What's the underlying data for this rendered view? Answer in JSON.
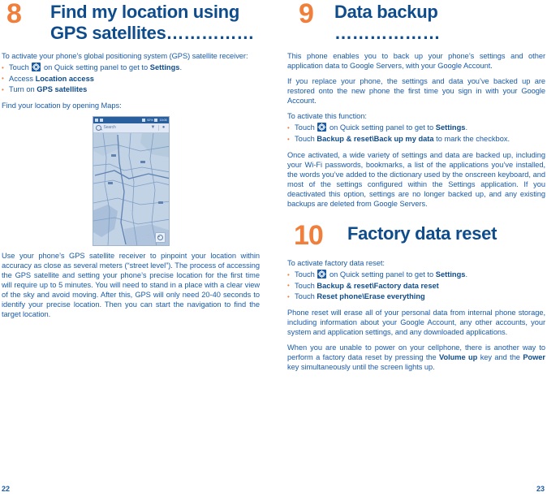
{
  "document": {
    "page_left_number": "22",
    "page_right_number": "23",
    "colors": {
      "chapter_number": "#f07f3c",
      "heading": "#0f4c8c",
      "body": "#1a5ba6",
      "bullet": "#f07f3c"
    }
  },
  "left_column": {
    "chapter": {
      "number": "8",
      "title": "Find my location using GPS satellites……………"
    },
    "intro": "To activate your phone’s global positioning system (GPS) satellite receiver:",
    "bullets": [
      {
        "prefix": "Touch ",
        "icon": "gear-icon",
        "middle": " on Quick setting panel to get to ",
        "bold": "Settings",
        "suffix": "."
      },
      {
        "prefix": "Access ",
        "icon": null,
        "middle": "",
        "bold": "Location access",
        "suffix": ""
      },
      {
        "prefix": "Turn on ",
        "icon": null,
        "middle": "",
        "bold": "GPS satellites",
        "suffix": ""
      }
    ],
    "maps_line": "Find your location by opening Maps:",
    "phone_screenshot": {
      "app_name": "maps-app",
      "status_battery": "92%",
      "status_time": "15:05",
      "search_placeholder": "Search",
      "search_icon": "search-icon",
      "layers_icon": "layers-icon",
      "person_icon": "person-icon",
      "my_location_icon": "my-location-icon"
    },
    "closing_paragraph": "Use your phone’s GPS satellite receiver to pinpoint your location within accuracy as close as several meters (“street level”). The process of accessing the GPS satellite and setting your phone’s precise location for the first time will require up to 5 minutes. You will need to stand in a place with a clear view of the sky and avoid moving. After this, GPS will only need 20-40 seconds to identify your precise location. Then you can start the navigation to find the target location."
  },
  "right_column": {
    "chapter9": {
      "number": "9",
      "title": "Data backup ………………",
      "paragraph1": "This phone enables you to back up your phone’s settings and other application data to Google Servers, with your Google Account.",
      "paragraph2": "If you replace your phone, the settings and data you’ve backed up are restored onto the new phone the first time you sign in with your Google Account.",
      "activate_line": "To activate this function:",
      "bullets": [
        {
          "prefix": "Touch ",
          "icon": "gear-icon",
          "middle": " on Quick setting panel to get to ",
          "bold": "Settings",
          "suffix": "."
        },
        {
          "prefix": "Touch ",
          "icon": null,
          "middle": "",
          "bold": "Backup & reset\\Back up my data",
          "suffix": " to mark the checkbox."
        }
      ],
      "paragraph3": "Once activated, a wide variety of settings and data are backed up, including your Wi-Fi passwords, bookmarks, a list of the applications you’ve installed, the words you’ve added to the dictionary used by the onscreen keyboard, and most of the settings configured within the Settings application. If you deactivated this option, settings are no longer backed up, and any existing backups are deleted from Google Servers."
    },
    "chapter10": {
      "number": "10",
      "title": "Factory data reset",
      "activate_line": "To activate factory data reset:",
      "bullets": [
        {
          "prefix": "Touch ",
          "icon": "gear-icon",
          "middle": " on Quick setting panel to get to ",
          "bold": "Settings",
          "suffix": "."
        },
        {
          "prefix": "Touch ",
          "icon": null,
          "middle": "",
          "bold": "Backup & reset\\Factory data reset",
          "suffix": ""
        },
        {
          "prefix": "Touch ",
          "icon": null,
          "middle": "",
          "bold": "Reset phone\\Erase everything",
          "suffix": ""
        }
      ],
      "paragraph1": "Phone reset will erase all of your personal data from internal phone storage, including information about your Google Account, any other accounts, your system and application settings, and any downloaded applications.",
      "paragraph2_part1": "When you are unable to power on your cellphone, there is another way to perform a factory data reset by pressing the ",
      "paragraph2_bold1": "Volume up",
      "paragraph2_part2": " key and the ",
      "paragraph2_bold2": "Power",
      "paragraph2_part3": " key simultaneously until the screen lights up."
    }
  }
}
